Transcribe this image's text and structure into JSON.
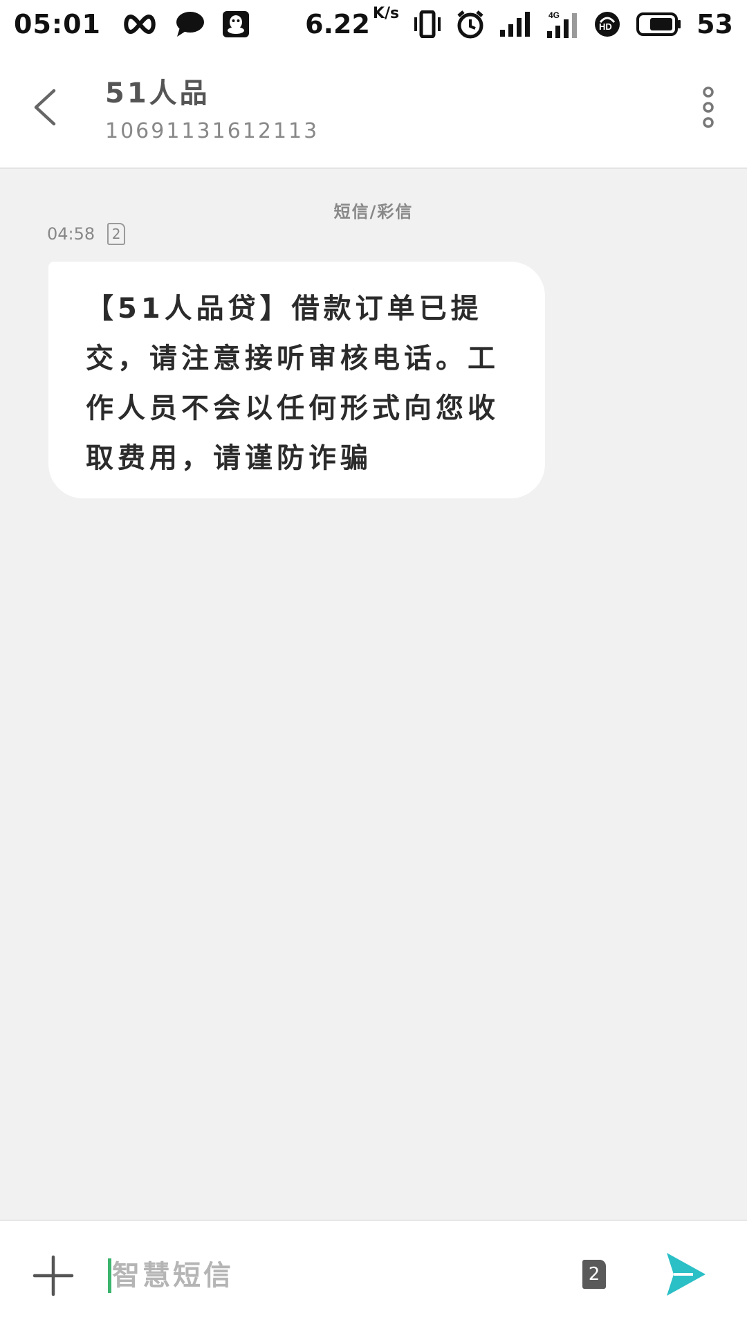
{
  "status_bar": {
    "time": "05:01",
    "net_speed": "6.22",
    "net_speed_unit": "K/s",
    "battery_percent": "53",
    "icons": [
      "infinity-icon",
      "chat-bubble-icon",
      "qq-icon",
      "vibrate-icon",
      "alarm-icon",
      "signal-icon",
      "signal-4g-icon",
      "hd-voice-icon",
      "battery-icon"
    ]
  },
  "header": {
    "contact_name": "51人品",
    "contact_number": "10691131612113",
    "icons": [
      "back-arrow-icon",
      "more-vertical-icon"
    ]
  },
  "conversation": {
    "type_label": "短信/彩信",
    "messages": [
      {
        "time": "04:58",
        "sim": "2",
        "text": "【51人品贷】借款订单已提交，请注意接听审核电话。工作人员不会以任何形式向您收取费用，请谨防诈骗"
      }
    ]
  },
  "composer": {
    "placeholder": "智慧短信",
    "value": "",
    "sim": "2",
    "icons": [
      "plus-icon",
      "send-icon"
    ]
  },
  "colors": {
    "background": "#f1f1f1",
    "bubble": "#ffffff",
    "send_accent": "#2bbfc6",
    "cursor": "#3cb46e"
  }
}
